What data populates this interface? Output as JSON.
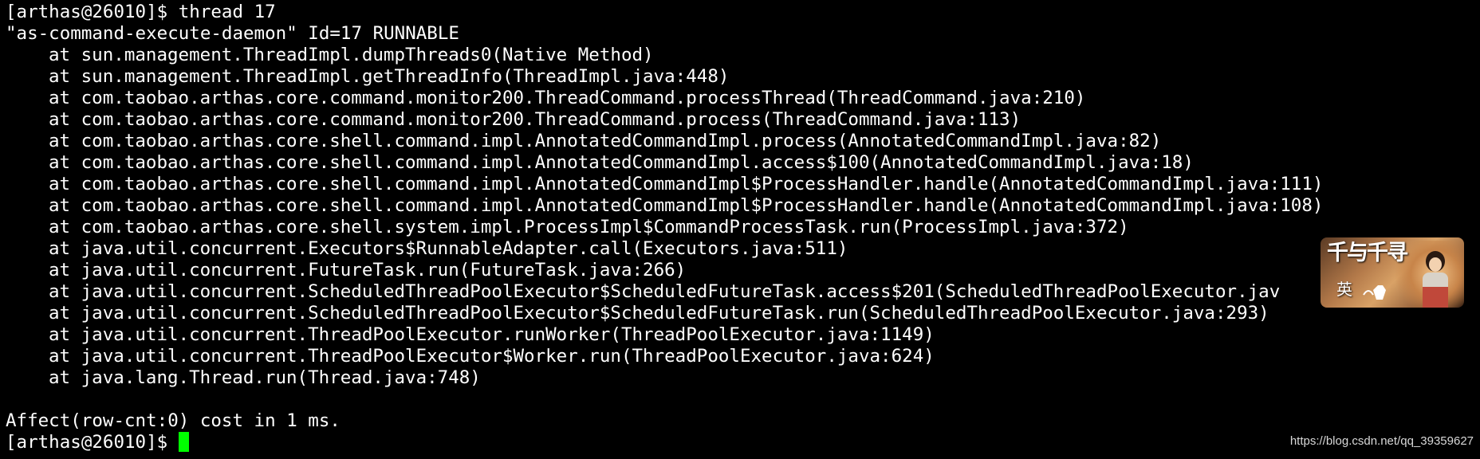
{
  "terminal": {
    "prompt": "[arthas@26010]$ ",
    "command": "thread 17",
    "thread_header": "\"as-command-execute-daemon\" Id=17 RUNNABLE",
    "stack_frames": [
      "at sun.management.ThreadImpl.dumpThreads0(Native Method)",
      "at sun.management.ThreadImpl.getThreadInfo(ThreadImpl.java:448)",
      "at com.taobao.arthas.core.command.monitor200.ThreadCommand.processThread(ThreadCommand.java:210)",
      "at com.taobao.arthas.core.command.monitor200.ThreadCommand.process(ThreadCommand.java:113)",
      "at com.taobao.arthas.core.shell.command.impl.AnnotatedCommandImpl.process(AnnotatedCommandImpl.java:82)",
      "at com.taobao.arthas.core.shell.command.impl.AnnotatedCommandImpl.access$100(AnnotatedCommandImpl.java:18)",
      "at com.taobao.arthas.core.shell.command.impl.AnnotatedCommandImpl$ProcessHandler.handle(AnnotatedCommandImpl.java:111)",
      "at com.taobao.arthas.core.shell.command.impl.AnnotatedCommandImpl$ProcessHandler.handle(AnnotatedCommandImpl.java:108)",
      "at com.taobao.arthas.core.shell.system.impl.ProcessImpl$CommandProcessTask.run(ProcessImpl.java:372)",
      "at java.util.concurrent.Executors$RunnableAdapter.call(Executors.java:511)",
      "at java.util.concurrent.FutureTask.run(FutureTask.java:266)",
      "at java.util.concurrent.ScheduledThreadPoolExecutor$ScheduledFutureTask.access$201(ScheduledThreadPoolExecutor.jav",
      "at java.util.concurrent.ScheduledThreadPoolExecutor$ScheduledFutureTask.run(ScheduledThreadPoolExecutor.java:293)",
      "at java.util.concurrent.ThreadPoolExecutor.runWorker(ThreadPoolExecutor.java:1149)",
      "at java.util.concurrent.ThreadPoolExecutor$Worker.run(ThreadPoolExecutor.java:624)",
      "at java.lang.Thread.run(Thread.java:748)"
    ],
    "summary": "Affect(row-cnt:0) cost in 1 ms.",
    "cursor_color": "#00ff00",
    "background_color": "#000000",
    "text_color": "#ffffff"
  },
  "overlay_image": {
    "title": "千与千寻",
    "subtitle": "英"
  },
  "watermark": "https://blog.csdn.net/qq_39359627"
}
